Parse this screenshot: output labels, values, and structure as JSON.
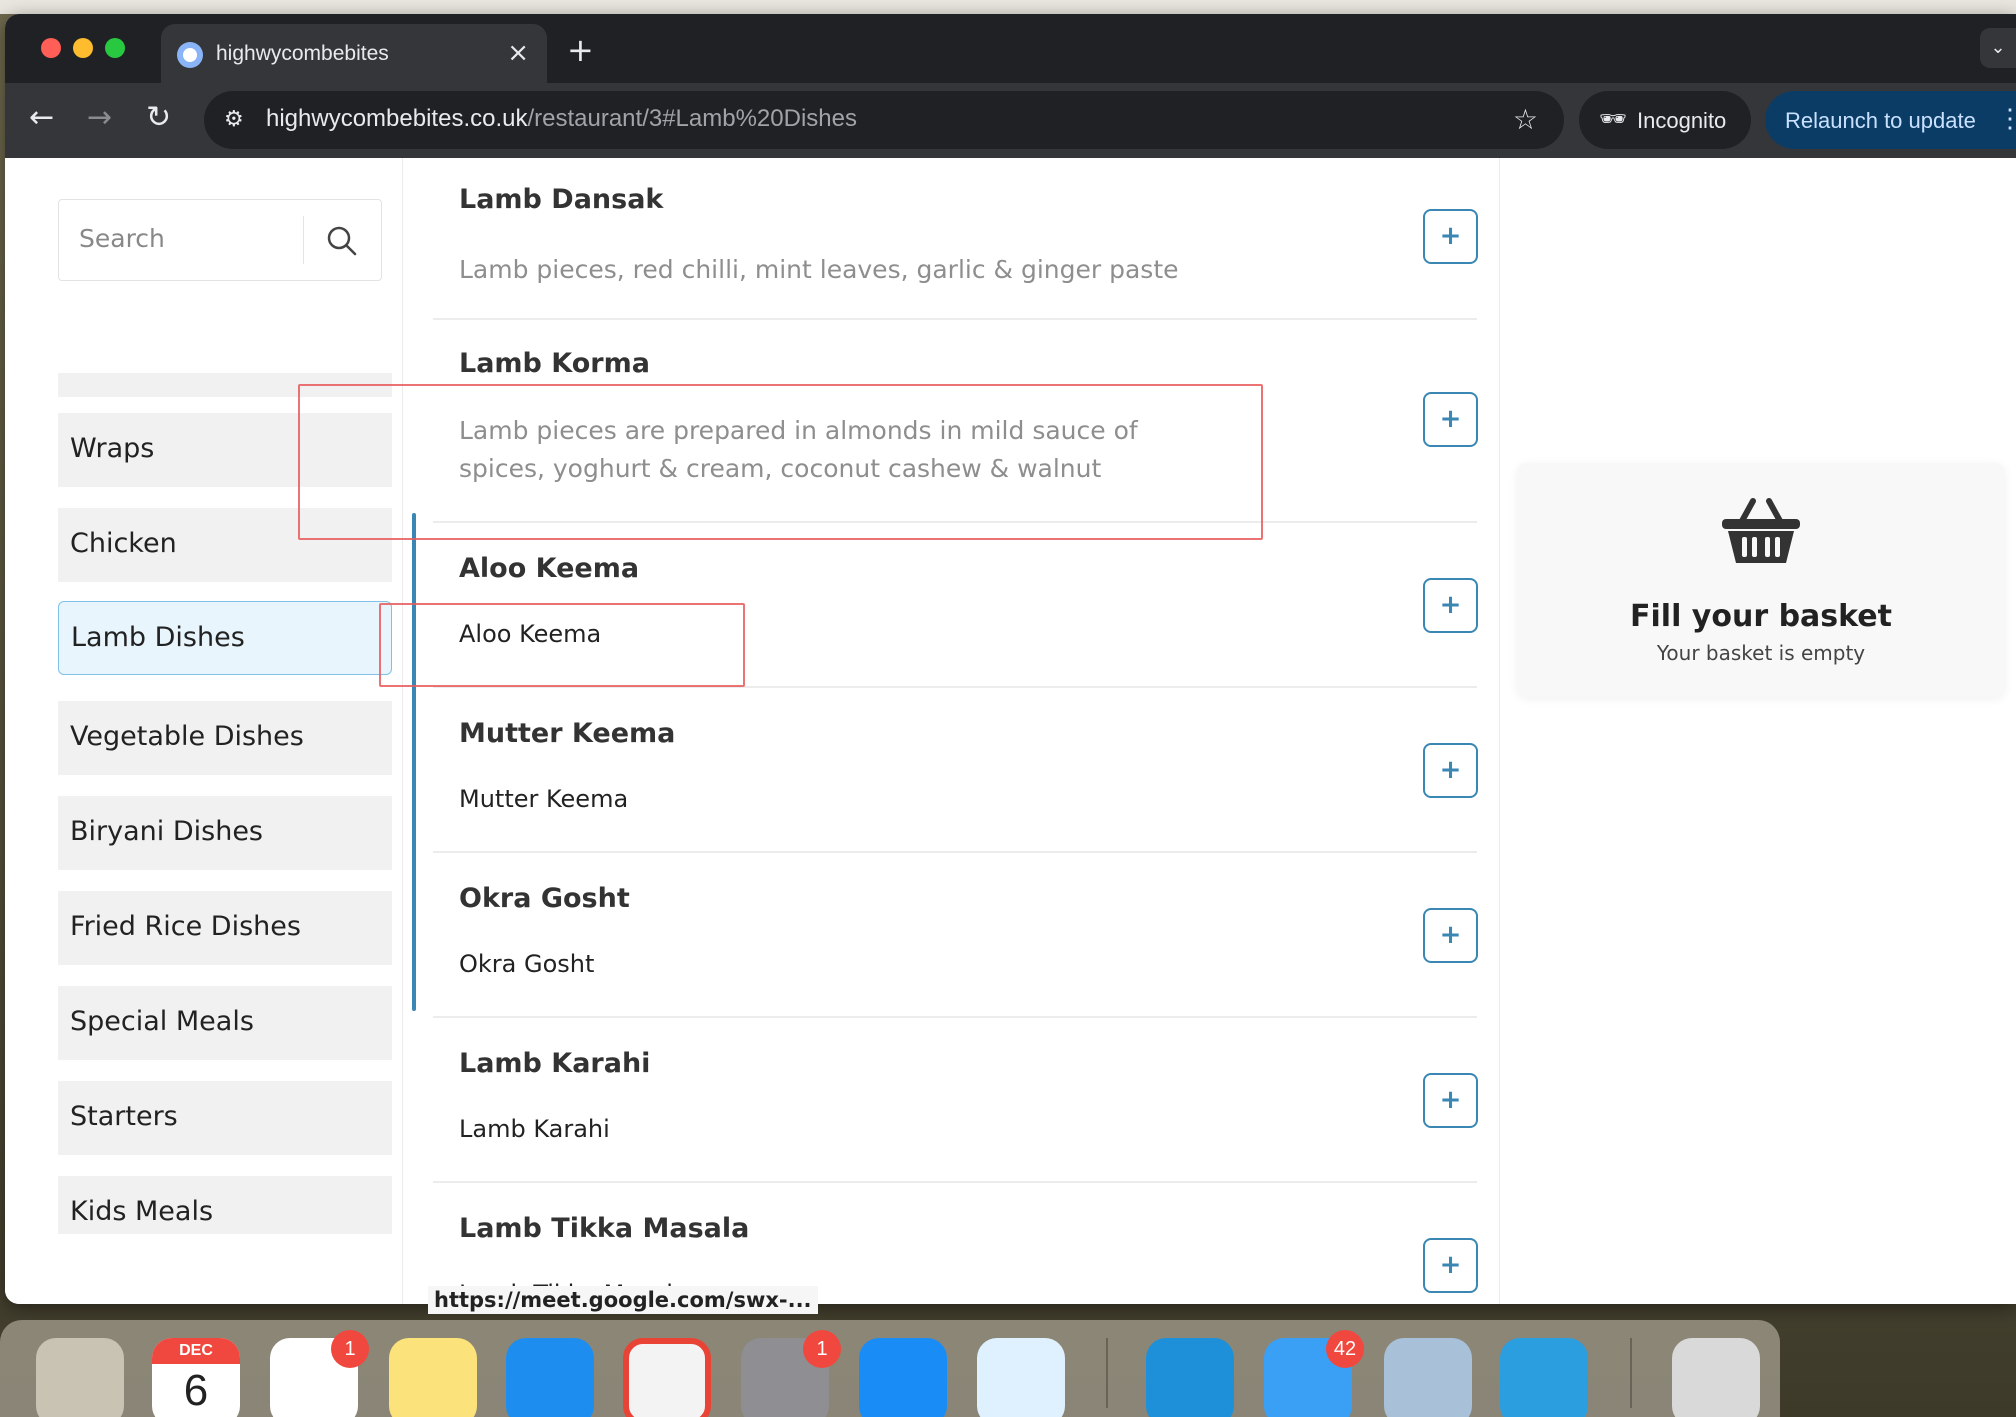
{
  "browser": {
    "tab_title": "highwycombebites",
    "tab_close": "×",
    "new_tab": "+",
    "url_host": "highwycombebites.co.uk",
    "url_path": "/restaurant/3#Lamb%20Dishes",
    "incognito_label": "Incognito",
    "relaunch_label": "Relaunch to update"
  },
  "search": {
    "placeholder": "Search"
  },
  "categories": [
    {
      "label": ""
    },
    {
      "label": "Wraps"
    },
    {
      "label": "Chicken"
    },
    {
      "label": "Lamb Dishes",
      "active": true
    },
    {
      "label": "Vegetable Dishes"
    },
    {
      "label": "Biryani Dishes"
    },
    {
      "label": "Fried Rice Dishes"
    },
    {
      "label": "Special Meals"
    },
    {
      "label": "Starters"
    },
    {
      "label": "Kids Meals"
    }
  ],
  "menu_items": [
    {
      "name": "Lamb Dansak",
      "desc": "Lamb pieces, red chilli, mint leaves, garlic & ginger paste"
    },
    {
      "name": "Lamb Korma",
      "desc": "Lamb pieces are prepared in almonds in mild sauce of spices, yoghurt & cream, coconut cashew & walnut"
    },
    {
      "name": "Aloo Keema",
      "desc": "Aloo Keema"
    },
    {
      "name": "Mutter Keema",
      "desc": "Mutter Keema"
    },
    {
      "name": "Okra Gosht",
      "desc": "Okra Gosht"
    },
    {
      "name": "Lamb Karahi",
      "desc": "Lamb Karahi"
    },
    {
      "name": "Lamb Tikka Masala",
      "desc": "Lamb Tikka Masala"
    }
  ],
  "add_button_label": "+",
  "basket": {
    "title": "Fill your basket",
    "subtitle": "Your basket is empty"
  },
  "status_bar_link": "https://meet.google.com/swx-...",
  "dock": {
    "calendar_month": "DEC",
    "calendar_day": "6",
    "badges": {
      "reminders": "1",
      "settings": "1",
      "mail": "42"
    }
  },
  "colors": {
    "accent": "#3a87b3",
    "active_category_bg": "#e8f5fd",
    "annotation": "#e85a5a"
  }
}
